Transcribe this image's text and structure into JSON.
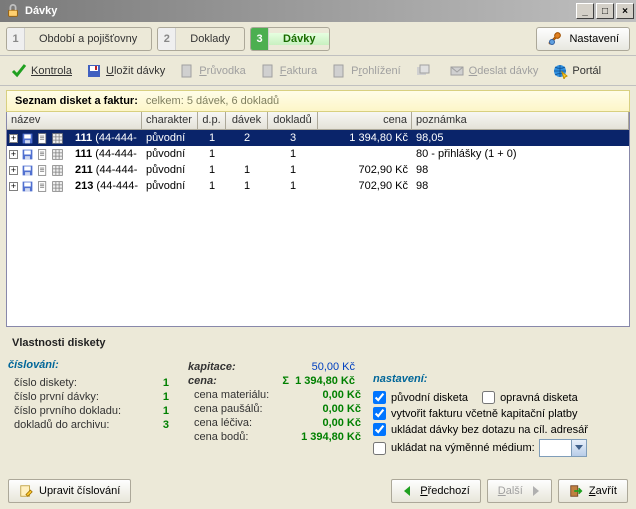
{
  "window": {
    "title": "Dávky",
    "min_label": "_",
    "max_label": "□",
    "close_label": "×"
  },
  "steps": {
    "s1_num": "1",
    "s1_label": "Období a pojišťovny",
    "s2_num": "2",
    "s2_label": "Doklady",
    "s3_num": "3",
    "s3_label": "Dávky",
    "settings_label": "Nastavení"
  },
  "toolbar": {
    "kontrola": "Kontrola",
    "ulozit": "Uložit dávky",
    "pruvodka": "Průvodka",
    "faktura": "Faktura",
    "prohlizeni": "Prohlížení",
    "odeslat": "Odeslat dávky",
    "portal": "Portál"
  },
  "listheader": {
    "title": "Seznam disket a faktur:",
    "summary": "celkem: 5 dávek, 6 dokladů"
  },
  "columns": {
    "name": "název",
    "char": "charakter",
    "dp": "d.p.",
    "dav": "dávek",
    "dok": "dokladů",
    "cena": "cena",
    "pozn": "poznámka"
  },
  "rows": [
    {
      "name_bold": "111",
      "name_rest": " (44-444-",
      "char": "původní",
      "dp": "1",
      "dav": "2",
      "dok": "3",
      "cena": "1 394,80 Kč",
      "pozn": "98,05",
      "selected": true
    },
    {
      "name_bold": "111",
      "name_rest": " (44-444-",
      "char": "původní",
      "dp": "1",
      "dav": "",
      "dok": "1",
      "cena": "",
      "pozn": "80 - přihlášky (1 + 0)",
      "selected": false
    },
    {
      "name_bold": "211",
      "name_rest": " (44-444-",
      "char": "původní",
      "dp": "1",
      "dav": "1",
      "dok": "1",
      "cena": "702,90 Kč",
      "pozn": "98",
      "selected": false
    },
    {
      "name_bold": "213",
      "name_rest": " (44-444-",
      "char": "původní",
      "dp": "1",
      "dav": "1",
      "dok": "1",
      "cena": "702,90 Kč",
      "pozn": "98",
      "selected": false
    }
  ],
  "props": {
    "title": "Vlastnosti diskety",
    "cislovani_h": "číslování:",
    "cislo_diskety_l": "číslo diskety:",
    "cislo_diskety_v": "1",
    "cislo_prvni_l": "číslo první dávky:",
    "cislo_prvni_v": "1",
    "cislo_dokladu_l": "číslo prvního dokladu:",
    "cislo_dokladu_v": "1",
    "dokladu_arch_l": "dokladů do archivu:",
    "dokladu_arch_v": "3",
    "kapitace_l": "kapitace:",
    "kapitace_v": "50,00 Kč",
    "cena_l": "cena:",
    "cena_sigma": "Σ",
    "cena_v": "1 394,80 Kč",
    "cena_mat_l": "cena materiálu:",
    "cena_mat_v": "0,00 Kč",
    "cena_pau_l": "cena paušálů:",
    "cena_pau_v": "0,00 Kč",
    "cena_lec_l": "cena léčiva:",
    "cena_lec_v": "0,00 Kč",
    "cena_bod_l": "cena bodů:",
    "cena_bod_v": "1 394,80 Kč",
    "nastaveni_h": "nastavení:",
    "ch_puvodni": "původní disketa",
    "ch_opravna": "opravná disketa",
    "ch_vytvorit": "vytvořit fakturu včetně kapitační platby",
    "ch_ukladat": "ukládat dávky bez dotazu na cíl. adresář",
    "ch_medium": "ukládat na výměnné médium:"
  },
  "buttons": {
    "upravit": "Upravit číslování",
    "predchozi": "Předchozí",
    "dalsi": "Další",
    "zavrit": "Zavřít"
  }
}
